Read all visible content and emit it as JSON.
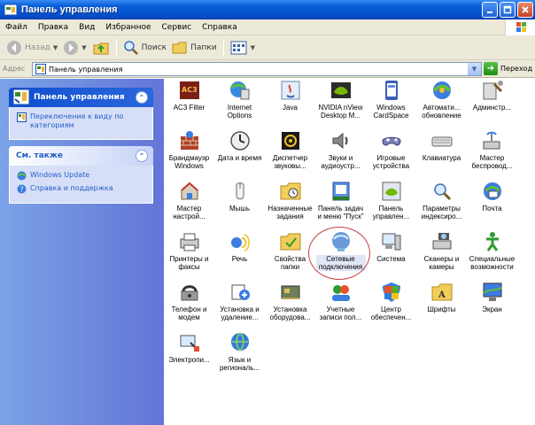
{
  "window": {
    "title": "Панель управления"
  },
  "menu": [
    "Файл",
    "Правка",
    "Вид",
    "Избранное",
    "Сервис",
    "Справка"
  ],
  "toolbar": {
    "back": "Назад",
    "search": "Поиск",
    "folders": "Папки"
  },
  "address": {
    "label": "Адрес",
    "value": "Панель управления",
    "go": "Переход"
  },
  "panel": {
    "title": "Панель управления",
    "switch_link": "Переключение к виду по категориям"
  },
  "see_also": {
    "title": "См. также",
    "links": [
      "Windows Update",
      "Справка и поддержка"
    ]
  },
  "items": [
    {
      "label": "AC3 Filter",
      "icon": "ac3-filter-icon"
    },
    {
      "label": "Internet Options",
      "icon": "internet-options-icon"
    },
    {
      "label": "Java",
      "icon": "java-icon"
    },
    {
      "label": "NVIDIA nView Desktop M...",
      "icon": "nvidia-nview-icon"
    },
    {
      "label": "Windows CardSpace",
      "icon": "cardspace-icon"
    },
    {
      "label": "Автомати... обновление",
      "icon": "automatic-updates-icon"
    },
    {
      "label": "Админстр...",
      "icon": "admin-tools-icon"
    },
    {
      "label": "",
      "icon": ""
    },
    {
      "label": "Брандмауэр Windows",
      "icon": "firewall-icon"
    },
    {
      "label": "Дата и время",
      "icon": "date-time-icon"
    },
    {
      "label": "Диспетчер звуковы...",
      "icon": "sound-manager-icon"
    },
    {
      "label": "Звуки и аудиоустр...",
      "icon": "sounds-audio-icon"
    },
    {
      "label": "Игровые устройства",
      "icon": "game-controllers-icon"
    },
    {
      "label": "Клавиатура",
      "icon": "keyboard-icon"
    },
    {
      "label": "Мастер беспровод...",
      "icon": "wireless-wizard-icon"
    },
    {
      "label": "",
      "icon": ""
    },
    {
      "label": "Мастер настрой...",
      "icon": "network-setup-wizard-icon"
    },
    {
      "label": "Мышь",
      "icon": "mouse-icon"
    },
    {
      "label": "Назначенные задания",
      "icon": "scheduled-tasks-icon"
    },
    {
      "label": "Панель задач и меню \"Пуск\"",
      "icon": "taskbar-start-icon"
    },
    {
      "label": "Панель управлен...",
      "icon": "nvidia-control-panel-icon"
    },
    {
      "label": "Параметры индексиро...",
      "icon": "indexing-options-icon"
    },
    {
      "label": "Почта",
      "icon": "mail-icon"
    },
    {
      "label": "",
      "icon": ""
    },
    {
      "label": "Принтеры и факсы",
      "icon": "printers-faxes-icon"
    },
    {
      "label": "Речь",
      "icon": "speech-icon"
    },
    {
      "label": "Свойства папки",
      "icon": "folder-options-icon"
    },
    {
      "label": "Сетевые подключения",
      "icon": "network-connections-icon",
      "selected": true
    },
    {
      "label": "Система",
      "icon": "system-icon"
    },
    {
      "label": "Сканеры и камеры",
      "icon": "scanners-cameras-icon"
    },
    {
      "label": "Специальные возможности",
      "icon": "accessibility-icon"
    },
    {
      "label": "",
      "icon": ""
    },
    {
      "label": "Телефон и модем",
      "icon": "phone-modem-icon"
    },
    {
      "label": "Установка и удаление...",
      "icon": "add-remove-programs-icon"
    },
    {
      "label": "Установка оборудова...",
      "icon": "add-hardware-icon"
    },
    {
      "label": "Учетные записи пол...",
      "icon": "user-accounts-icon"
    },
    {
      "label": "Центр обеспечен...",
      "icon": "security-center-icon"
    },
    {
      "label": "Шрифты",
      "icon": "fonts-icon"
    },
    {
      "label": "Экран",
      "icon": "display-icon"
    },
    {
      "label": "",
      "icon": ""
    },
    {
      "label": "Электропи...",
      "icon": "power-options-icon"
    },
    {
      "label": "Язык и региональ...",
      "icon": "regional-language-icon"
    }
  ]
}
